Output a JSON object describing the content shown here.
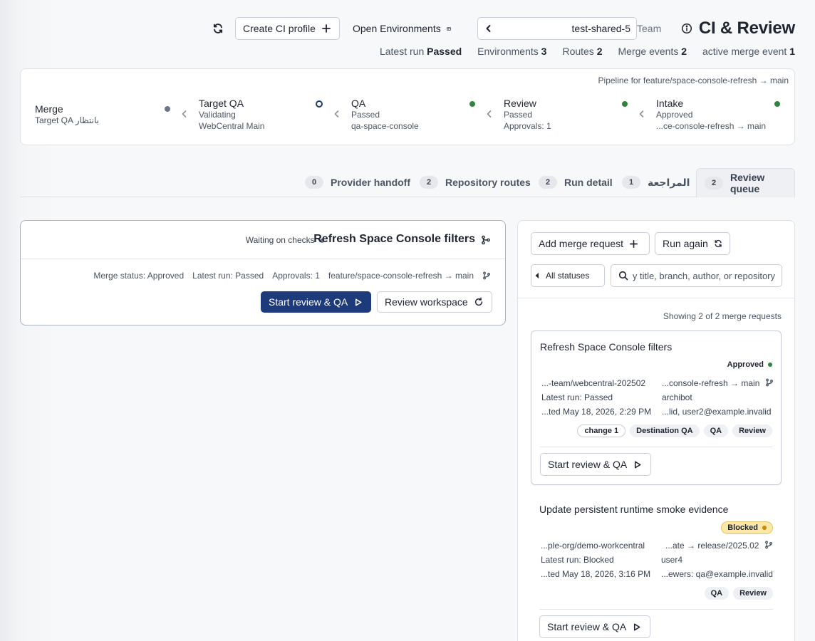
{
  "header": {
    "refresh_icon": "refresh-icon",
    "create_ci_profile_label": "Create CI profile",
    "open_environments_label": "Open Environments",
    "env_select_value": "test-shared-5",
    "team_label": "Team",
    "title": "CI & Review"
  },
  "stats": {
    "latest_run_label": "Latest run",
    "latest_run_value": "Passed",
    "environments_label": "Environments",
    "environments_value": "3",
    "routes_label": "Routes",
    "routes_value": "2",
    "merge_events_label": "Merge events",
    "merge_events_value": "2",
    "active_merge_event_label": "active merge event",
    "active_merge_event_value": "1"
  },
  "pipeline": {
    "caption": "Pipeline for feature/space-console-refresh → main",
    "stages": [
      {
        "name": "Merge",
        "lines": [
          "Target QA بانتظار"
        ],
        "status": "pending"
      },
      {
        "name": "Target QA",
        "lines": [
          "Validating",
          "WebCentral Main"
        ],
        "status": "active"
      },
      {
        "name": "QA",
        "lines": [
          "Passed",
          "qa-space-console"
        ],
        "status": "passed"
      },
      {
        "name": "Review",
        "lines": [
          "Passed",
          "Approvals: 1"
        ],
        "status": "passed"
      },
      {
        "name": "Intake",
        "lines": [
          "Approved",
          "...ce-console-refresh → main"
        ],
        "status": "passed"
      }
    ],
    "colors": {
      "passed": "#2e8540",
      "pending": "#6b7688",
      "active": "#1d3a7a"
    }
  },
  "tabs": [
    {
      "count": "0",
      "label": "Provider handoff"
    },
    {
      "count": "2",
      "label": "Repository routes"
    },
    {
      "count": "2",
      "label": "Run detail"
    },
    {
      "count": "1",
      "label": "المراجعة"
    },
    {
      "count": "2",
      "label": "Review queue",
      "active": true
    }
  ],
  "detail": {
    "title": "Refresh Space Console filters",
    "status": "Waiting on checks",
    "meta": {
      "merge_status": "Merge status: Approved",
      "latest_run": "Latest run: Passed",
      "approvals": "Approvals: 1",
      "branch": "feature/space-console-refresh → main"
    },
    "start_button": "Start review & QA",
    "workspace_button": "Review workspace"
  },
  "queue": {
    "add_merge_request_label": "Add merge request",
    "run_again_label": "Run again",
    "status_filter_value": "All statuses",
    "search_placeholder": "Search by title, branch, author, or repository",
    "showing_text": "Showing 2 of 2 merge requests",
    "items": [
      {
        "title": "Refresh Space Console filters",
        "status": "Approved",
        "left": [
          "...-team/webcentral-202502",
          "Latest run: Passed",
          "...ted May 18, 2026, 2:29 PM"
        ],
        "right": [
          "...console-refresh → main",
          "archibot",
          "...lid, user2@example.invalid"
        ],
        "chips": [
          "change 1",
          "Destination QA",
          "QA",
          "Review"
        ],
        "button": "Start review & QA"
      },
      {
        "title": "Update persistent runtime smoke evidence",
        "status": "Blocked",
        "left": [
          "...ple-org/demo-workcentral",
          "Latest run: Blocked",
          "...ted May 18, 2026, 3:16 PM"
        ],
        "right": [
          "...ate → release/2025.02",
          "user4",
          "...ewers: qa@example.invalid"
        ],
        "chips": [
          "QA",
          "Review"
        ],
        "button": "Start review & QA"
      }
    ],
    "colors": {
      "approved": "#2e8540",
      "blocked": "#c98a00"
    }
  }
}
